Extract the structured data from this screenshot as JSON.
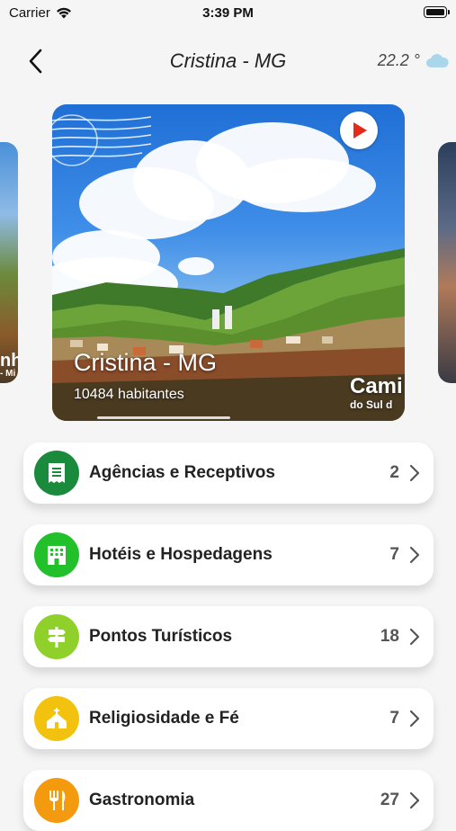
{
  "status_bar": {
    "carrier": "Carrier",
    "time": "3:39 PM"
  },
  "header": {
    "title": "Cristina - MG",
    "temperature": "22.2 °"
  },
  "featured_card": {
    "city_name": "Cristina - MG",
    "population": "10484 habitantes",
    "brand_line1": "Cami",
    "brand_line2": "do Sul d"
  },
  "side_cards": {
    "left_text": "nh",
    "left_subtext": "- Mi"
  },
  "categories": [
    {
      "label": "Agências e Receptivos",
      "count": "2",
      "color": "#1a8a3c",
      "icon": "document-icon"
    },
    {
      "label": "Hotéis e Hospedagens",
      "count": "7",
      "color": "#22c02a",
      "icon": "building-icon"
    },
    {
      "label": "Pontos Turísticos",
      "count": "18",
      "color": "#8fd12a",
      "icon": "signpost-icon"
    },
    {
      "label": "Religiosidade e Fé",
      "count": "7",
      "color": "#f3c20f",
      "icon": "church-icon"
    },
    {
      "label": "Gastronomia",
      "count": "27",
      "color": "#f39a0f",
      "icon": "fork-knife-icon"
    }
  ]
}
